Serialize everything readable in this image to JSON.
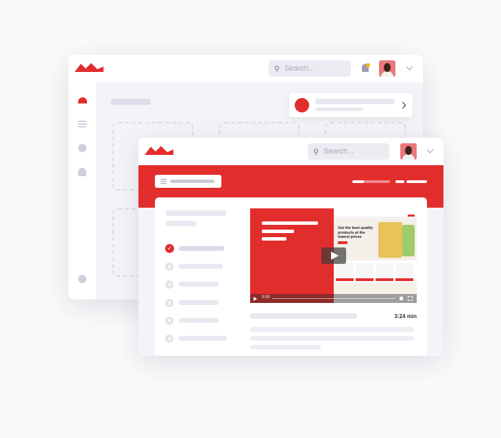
{
  "back_window": {
    "search_placeholder": "Search...",
    "icons": [
      "logo",
      "search-icon",
      "bell-icon",
      "avatar",
      "chevron-down-icon",
      "dashboard-icon",
      "list-icon",
      "pie-chart-icon",
      "user-icon",
      "gear-icon"
    ]
  },
  "front_window": {
    "search_placeholder": "Search...",
    "video": {
      "thumbnail_headline": "Get the best quality products at the lowest prices",
      "time_current": "0:00",
      "duration": "3:24 min"
    }
  },
  "colors": {
    "brand_red": "#e22d2d",
    "notification_dot": "#f5b800"
  }
}
